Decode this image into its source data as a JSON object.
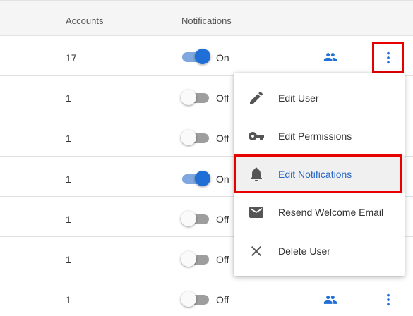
{
  "table": {
    "headers": {
      "accounts": "Accounts",
      "notifications": "Notifications"
    },
    "rows": [
      {
        "accounts": "17",
        "notification": "On"
      },
      {
        "accounts": "1",
        "notification": "Off"
      },
      {
        "accounts": "1",
        "notification": "Off"
      },
      {
        "accounts": "1",
        "notification": "On"
      },
      {
        "accounts": "1",
        "notification": "Off"
      },
      {
        "accounts": "1",
        "notification": "Off"
      },
      {
        "accounts": "1",
        "notification": "Off"
      }
    ]
  },
  "menu": {
    "items": [
      {
        "label": "Edit User",
        "icon": "pencil-icon"
      },
      {
        "label": "Edit Permissions",
        "icon": "key-icon"
      },
      {
        "label": "Edit Notifications",
        "icon": "bell-icon"
      },
      {
        "label": "Resend Welcome Email",
        "icon": "envelope-icon"
      },
      {
        "label": "Delete User",
        "icon": "close-icon"
      }
    ]
  },
  "colors": {
    "accent": "#1f6fd6",
    "highlight": "#e60000",
    "active_label": "#2a6ac6"
  }
}
